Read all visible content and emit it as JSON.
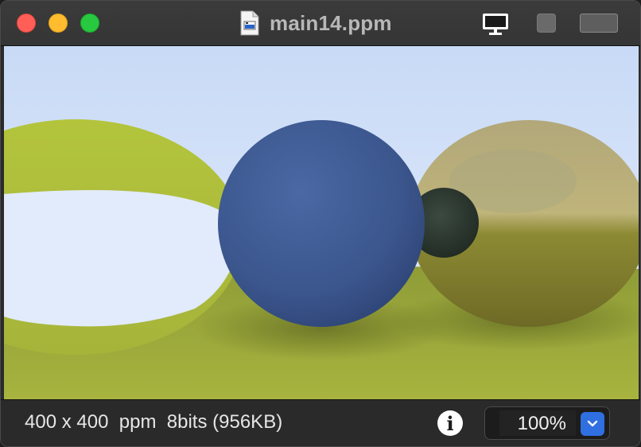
{
  "window": {
    "title": "main14.ppm",
    "file_icon": "document-image-icon",
    "buttons": {
      "close": "close-icon",
      "minimize": "minimize-icon",
      "maximize": "maximize-icon",
      "display": "monitor-icon",
      "square": "square-icon",
      "rect": "rectangle-icon"
    }
  },
  "image": {
    "description_icon": "rendered-scene-image"
  },
  "statusbar": {
    "info_text": "400 x 400  ppm  8bits (956KB)",
    "info_icon": "info-icon",
    "zoom_value": "100%",
    "zoom_dropdown_icon": "chevron-down-icon"
  },
  "colors": {
    "sky_top": "#c9dbf6",
    "sky_bottom": "#e4edfb",
    "ground": "#9aa83a",
    "blue_sphere": "#3e5a92",
    "left_sphere": "#b6c43e",
    "right_sphere": "#b5a86a",
    "accent": "#2f6fe0"
  }
}
